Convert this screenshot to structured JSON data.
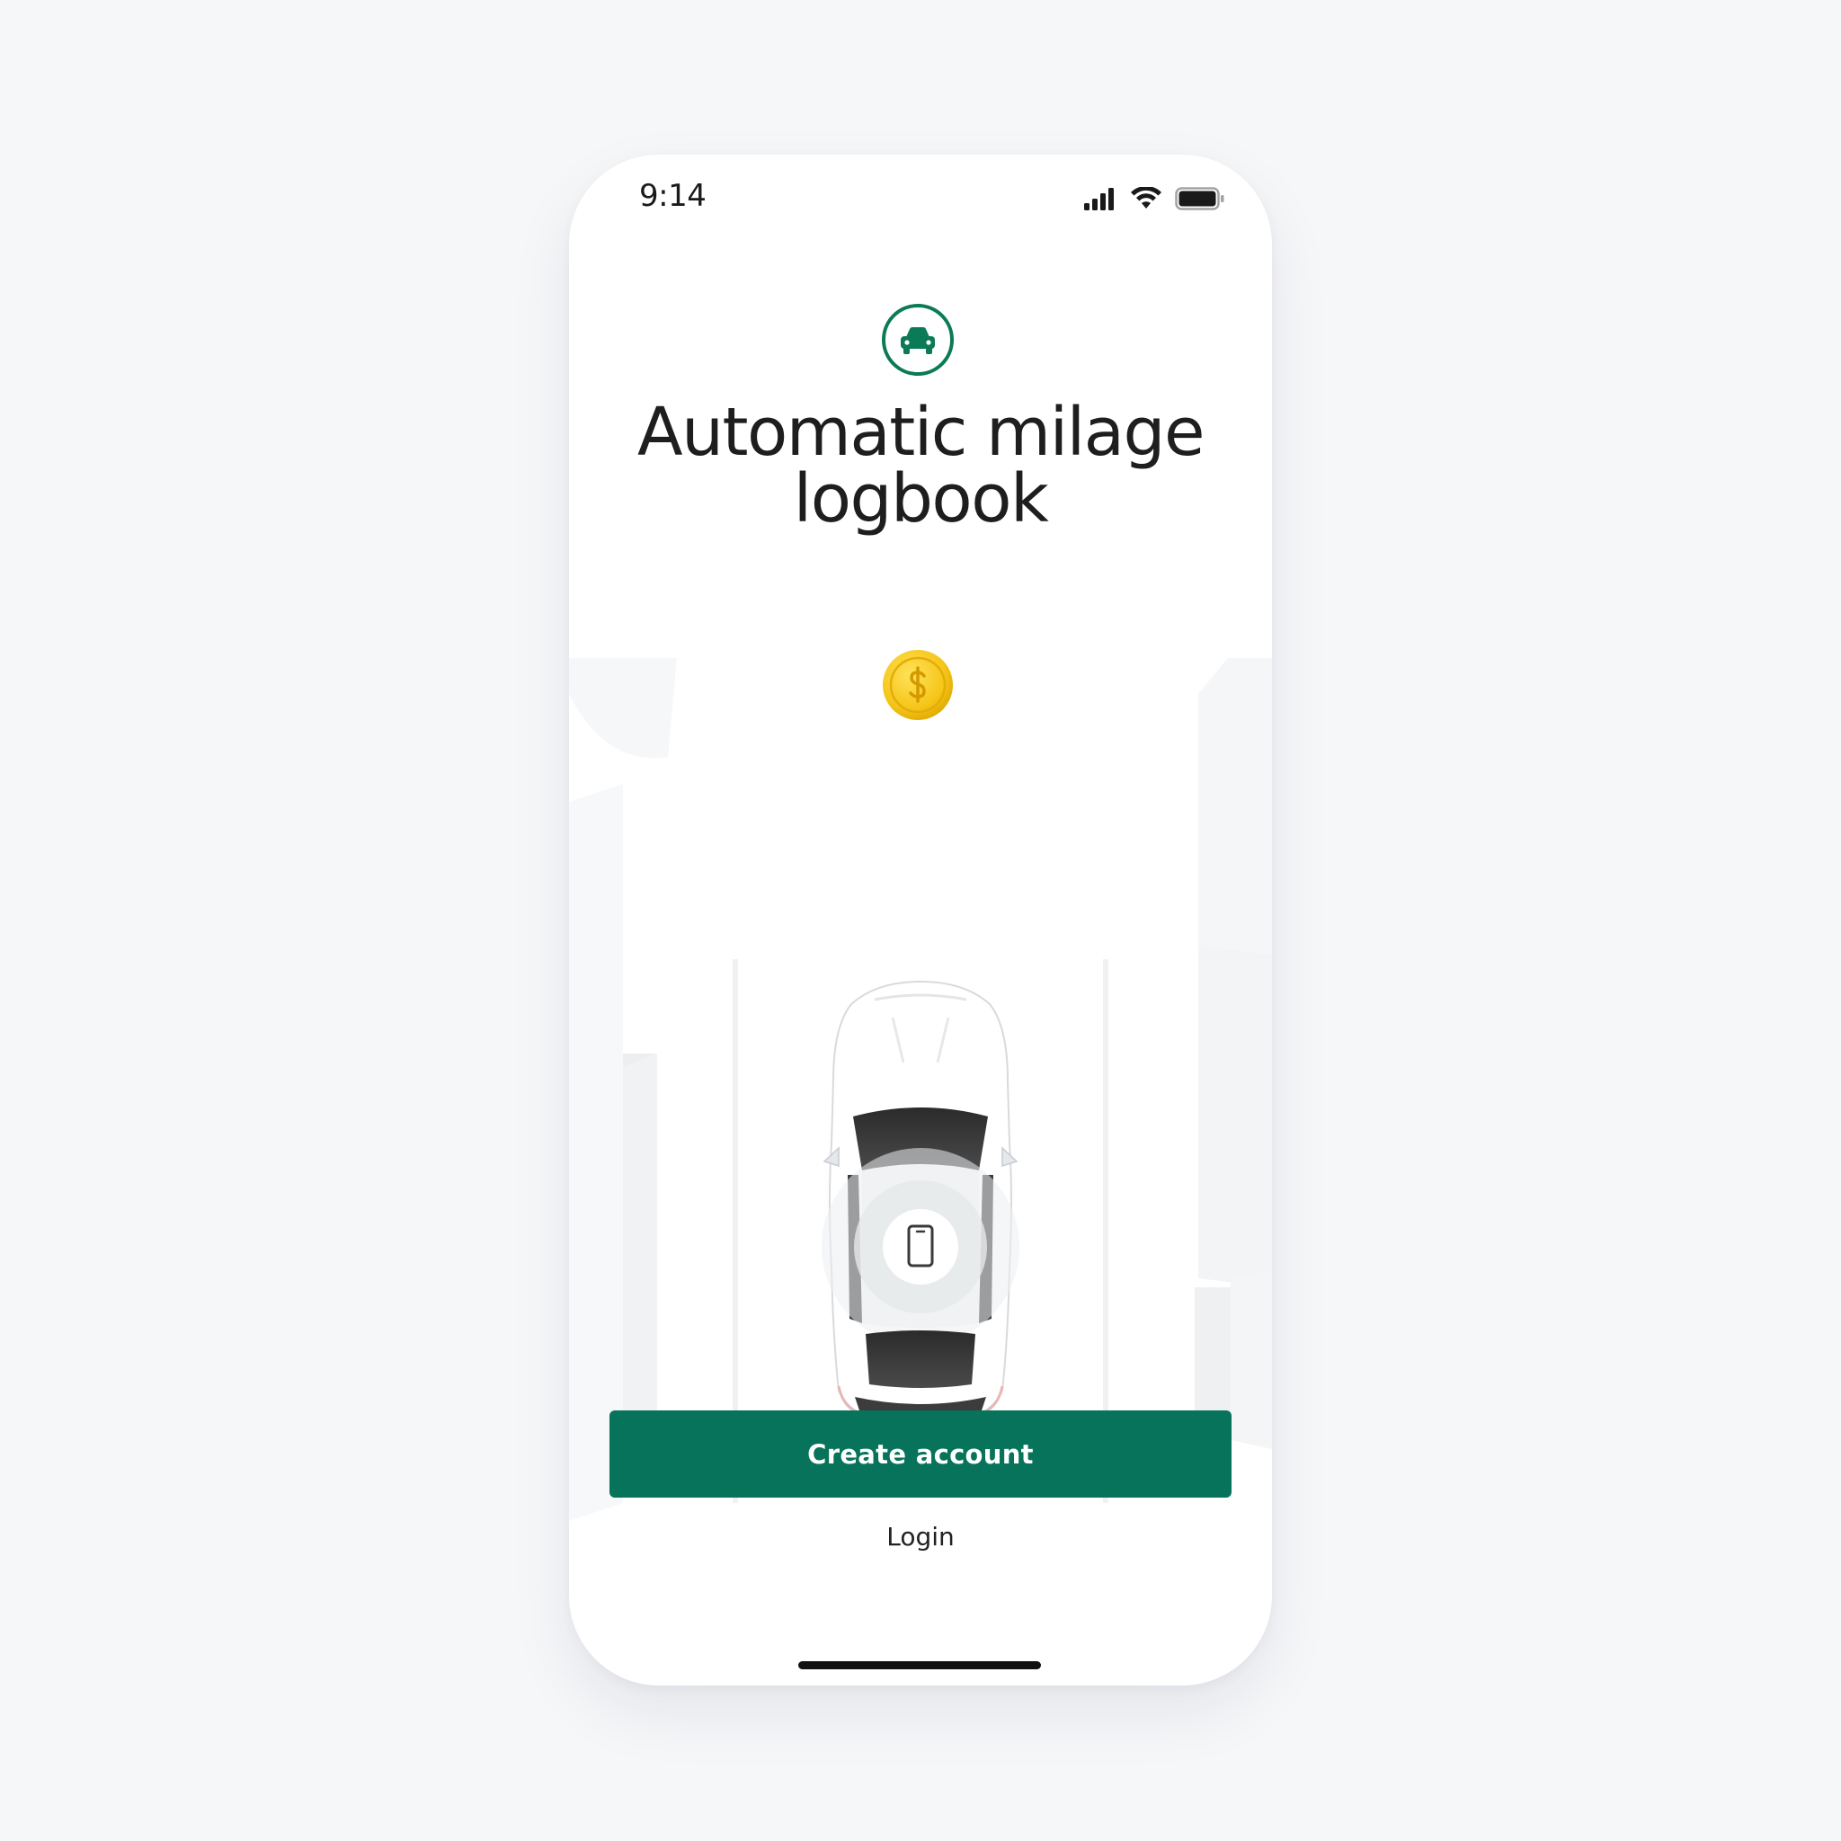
{
  "status_bar": {
    "time": "9:14",
    "signal_icon": "cellular-signal-icon",
    "wifi_icon": "wifi-icon",
    "battery_icon": "battery-icon"
  },
  "brand": {
    "icon": "car-icon",
    "accent_color": "#0b7a57"
  },
  "onboarding": {
    "title_line1": "Automatic milage",
    "title_line2": "logbook"
  },
  "illustration": {
    "coin_icon": "dollar-coin-icon",
    "car_image": "car-top-view",
    "phone_icon": "smartphone-icon"
  },
  "actions": {
    "create_account_label": "Create account",
    "login_label": "Login",
    "primary_color": "#06735a"
  }
}
